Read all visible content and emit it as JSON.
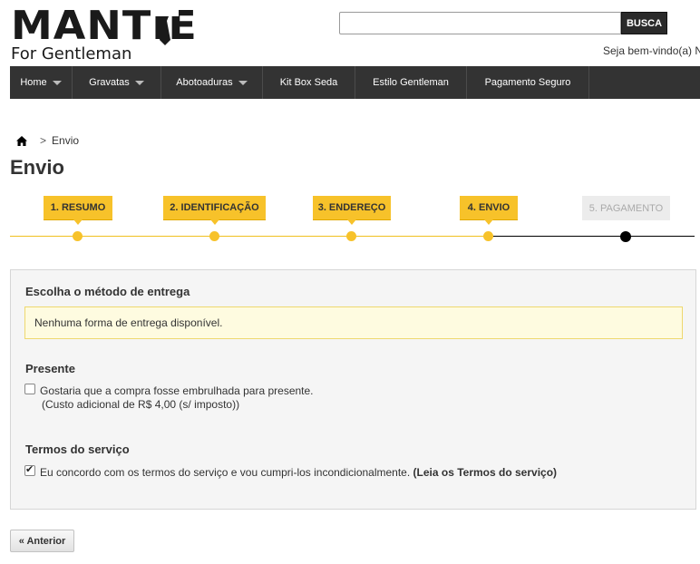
{
  "header": {
    "logo_main": "MANTIE",
    "logo_sub": "For Gentleman",
    "search": {
      "placeholder": "",
      "value": "",
      "button_label": "BUSCA"
    },
    "welcome_text": "Seja bem-vindo(a) N"
  },
  "nav": {
    "items": [
      {
        "label": "Home",
        "has_dropdown": true
      },
      {
        "label": "Gravatas",
        "has_dropdown": true
      },
      {
        "label": "Abotoaduras",
        "has_dropdown": true
      },
      {
        "label": "Kit Box Seda",
        "has_dropdown": false
      },
      {
        "label": "Estilo Gentleman",
        "has_dropdown": false
      },
      {
        "label": "Pagamento Seguro",
        "has_dropdown": false
      }
    ]
  },
  "breadcrumb": {
    "separator": ">",
    "current": "Envio"
  },
  "page_title": "Envio",
  "steps": [
    {
      "label": "1. RESUMO",
      "state": "done"
    },
    {
      "label": "2. IDENTIFICAÇÃO",
      "state": "done"
    },
    {
      "label": "3. ENDEREÇO",
      "state": "done"
    },
    {
      "label": "4. ENVIO",
      "state": "current"
    },
    {
      "label": "5. PAGAMENTO",
      "state": "inactive"
    }
  ],
  "shipping": {
    "title": "Escolha o método de entrega",
    "alert": "Nenhuma forma de entrega disponível."
  },
  "gift": {
    "title": "Presente",
    "checkbox_label": "Gostaria que a compra fosse embrulhada para presente.",
    "cost_note": "(Custo adicional de R$ 4,00 (s/ imposto))",
    "checked": false
  },
  "terms": {
    "title": "Termos do serviço",
    "checkbox_label": "Eu concordo com os termos do serviço e vou cumpri-los incondicionalmente.",
    "link_label": "(Leia os Termos do serviço)",
    "checked": true
  },
  "buttons": {
    "previous": "« Anterior"
  },
  "colors": {
    "accent": "#f7c22a",
    "nav_bg": "#333333",
    "alert_bg": "#fefbe0"
  }
}
